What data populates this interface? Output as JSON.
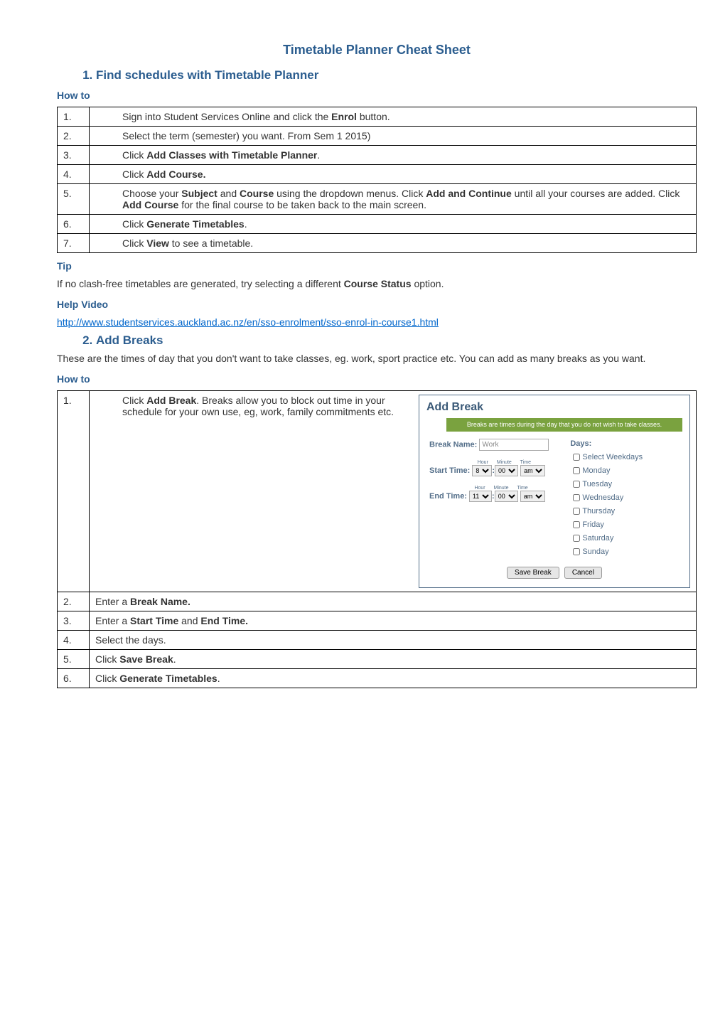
{
  "title": "Timetable Planner Cheat Sheet",
  "sections": [
    {
      "heading": "Find schedules with Timetable Planner",
      "howto_label": "How to",
      "steps": [
        {
          "num": "1.",
          "html": "Sign into Student Services Online and click the <b>Enrol</b> button."
        },
        {
          "num": "2.",
          "html": "Select the term (semester) you want. From Sem 1 2015)"
        },
        {
          "num": "3.",
          "html": "Click <b>Add Classes with Timetable Planner</b>."
        },
        {
          "num": "4.",
          "html": "Click <b>Add Course.</b>"
        },
        {
          "num": "5.",
          "html": "Choose your <b>Subject</b> and <b>Course</b> using the dropdown menus. Click <b>Add and Continue</b> until all your courses are added. Click <b>Add Course</b> for the final course to be taken back to the main screen.",
          "wrap": true
        },
        {
          "num": "6.",
          "html": "Click <b>Generate Timetables</b>."
        },
        {
          "num": "7.",
          "html": "Click <b>View</b> to see a timetable."
        }
      ],
      "tip_label": "Tip",
      "tip_html": "If no clash-free timetables are generated, try selecting a different <b>Course Status</b> option.",
      "help_video_label": "Help Video",
      "help_video_url": "http://www.studentservices.auckland.ac.nz/en/sso-enrolment/sso-enrol-in-course1.html"
    },
    {
      "heading": "Add Breaks",
      "intro": "These are the times of day that you don't want to take classes, eg. work, sport practice etc. You can add as many breaks as you want.",
      "howto_label": "How to",
      "steps": [
        {
          "num": "1.",
          "html": "Click <b>Add Break</b>. Breaks allow you to block out time in your schedule for your own use, eg, work, family commitments etc.",
          "has_image": true
        },
        {
          "num": "2.",
          "html": "Enter a <b>Break Name.</b>"
        },
        {
          "num": "3.",
          "html": "Enter a <b>Start Time</b> and <b>End Time.</b>"
        },
        {
          "num": "4.",
          "html": "Select the days."
        },
        {
          "num": "5.",
          "html": "Click <b>Save Break</b>."
        },
        {
          "num": "6.",
          "html": "Click <b>Generate Timetables</b>."
        }
      ]
    }
  ],
  "add_break_panel": {
    "title": "Add Break",
    "banner": "Breaks are times during the day that you do not wish to take classes.",
    "break_name_label": "Break Name:",
    "break_name_value": "Work",
    "start_time_label": "Start Time:",
    "end_time_label": "End Time:",
    "hour_label": "Hour",
    "minute_label": "Minute",
    "time_label": "Time",
    "start_hour": "8",
    "start_minute": "00",
    "start_ampm": "am",
    "end_hour": "11",
    "end_minute": "00",
    "end_ampm": "am",
    "days_label": "Days:",
    "days": [
      "Select Weekdays",
      "Monday",
      "Tuesday",
      "Wednesday",
      "Thursday",
      "Friday",
      "Saturday",
      "Sunday"
    ],
    "save_button": "Save Break",
    "cancel_button": "Cancel"
  }
}
